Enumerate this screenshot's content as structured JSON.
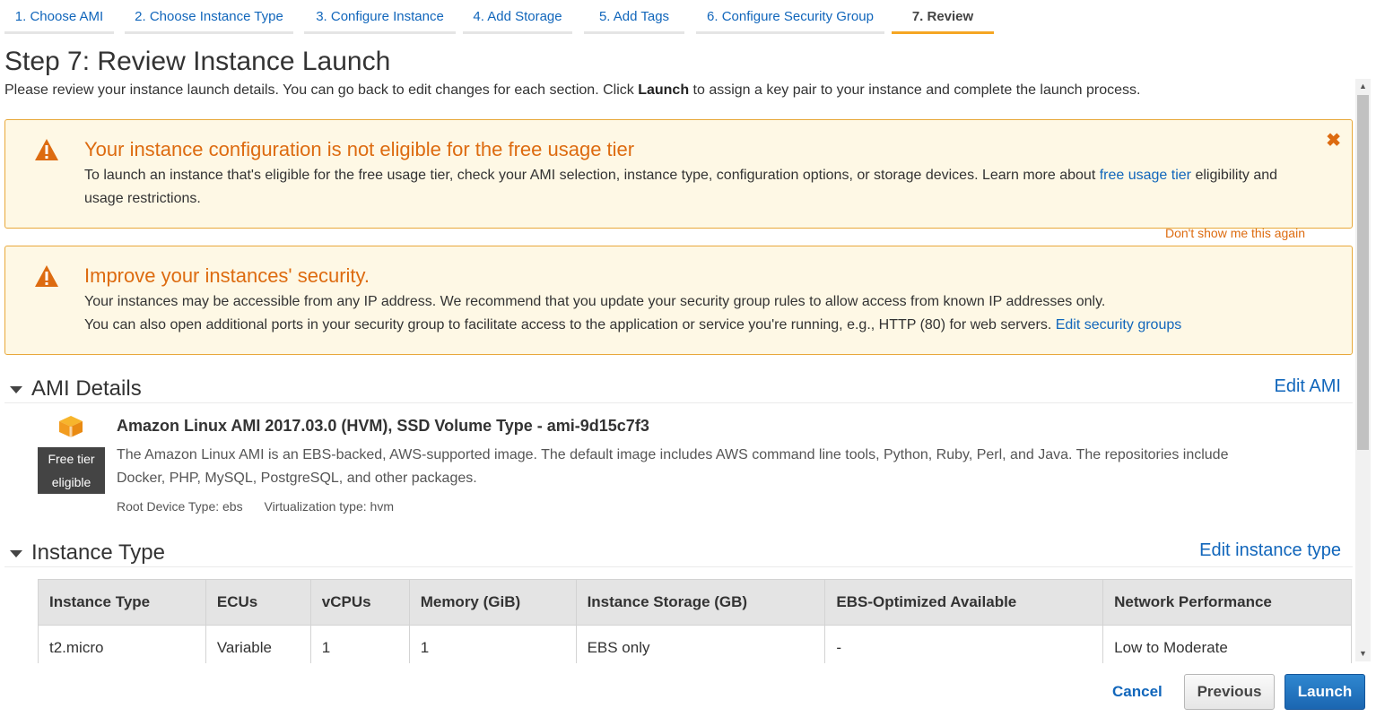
{
  "tabs": [
    {
      "label": "1. Choose AMI"
    },
    {
      "label": "2. Choose Instance Type"
    },
    {
      "label": "3. Configure Instance"
    },
    {
      "label": "4. Add Storage"
    },
    {
      "label": "5. Add Tags"
    },
    {
      "label": "6. Configure Security Group"
    },
    {
      "label": "7. Review",
      "active": true
    }
  ],
  "page": {
    "title": "Step 7: Review Instance Launch",
    "intro_before": "Please review your instance launch details. You can go back to edit changes for each section. Click ",
    "intro_bold": "Launch",
    "intro_after": " to assign a key pair to your instance and complete the launch process."
  },
  "alerts": {
    "free_tier": {
      "title": "Your instance configuration is not eligible for the free usage tier",
      "body_before": "To launch an instance that's eligible for the free usage tier, check your AMI selection, instance type, configuration options, or storage devices. Learn more about ",
      "link": "free usage tier",
      "body_after": " eligibility and usage restrictions.",
      "close_icon": "close-icon",
      "dont_show": "Don't show me this again"
    },
    "security": {
      "title": "Improve your instances' security.",
      "line1": "Your instances may be accessible from any IP address. We recommend that you update your security group rules to allow access from known IP addresses only.",
      "line2": "You can also open additional ports in your security group to facilitate access to the application or service you're running, e.g., HTTP (80) for web servers. ",
      "link": "Edit security groups"
    }
  },
  "ami_section": {
    "title": "AMI Details",
    "edit": "Edit AMI",
    "name": "Amazon Linux AMI 2017.03.0 (HVM), SSD Volume Type - ami-9d15c7f3",
    "badge_line1": "Free tier",
    "badge_line2": "eligible",
    "description": "The Amazon Linux AMI is an EBS-backed, AWS-supported image. The default image includes AWS command line tools, Python, Ruby, Perl, and Java. The repositories include Docker, PHP, MySQL, PostgreSQL, and other packages.",
    "root_device": "Root Device Type: ebs",
    "virtualization": "Virtualization type: hvm"
  },
  "instance_section": {
    "title": "Instance Type",
    "edit": "Edit instance type",
    "columns": [
      "Instance Type",
      "ECUs",
      "vCPUs",
      "Memory (GiB)",
      "Instance Storage (GB)",
      "EBS-Optimized Available",
      "Network Performance"
    ],
    "rows": [
      [
        "t2.micro",
        "Variable",
        "1",
        "1",
        "EBS only",
        "-",
        "Low to Moderate"
      ]
    ]
  },
  "footer": {
    "cancel": "Cancel",
    "previous": "Previous",
    "launch": "Launch"
  },
  "colors": {
    "link": "#1166bb",
    "warning": "#dd6b10",
    "alert_bg": "#fef8e5",
    "active_tab": "#f5a623",
    "launch_button": "#1f6fbc"
  }
}
